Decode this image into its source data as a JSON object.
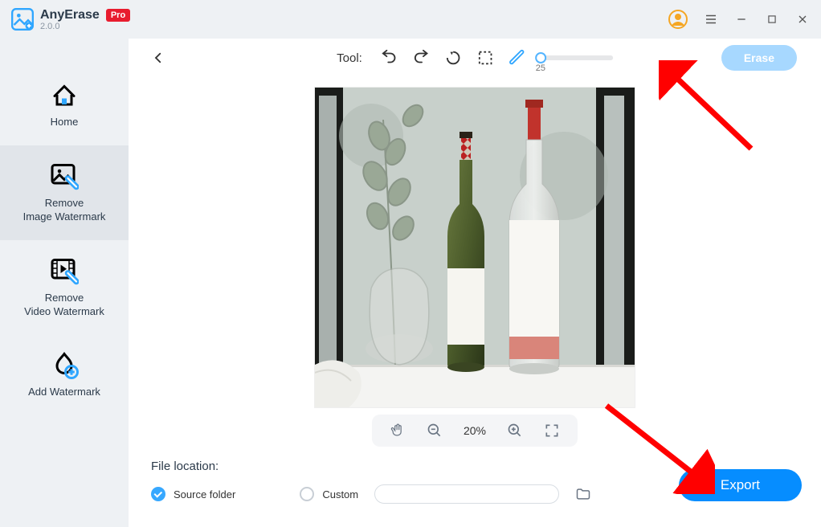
{
  "app": {
    "name": "AnyErase",
    "version": "2.0.0",
    "badge": "Pro"
  },
  "sidebar": {
    "items": [
      {
        "label": "Home"
      },
      {
        "label": "Remove\nImage Watermark"
      },
      {
        "label": "Remove\nVideo Watermark"
      },
      {
        "label": "Add Watermark"
      }
    ],
    "active_index": 1
  },
  "toolbar": {
    "label": "Tool:",
    "brush_size": "25",
    "erase_label": "Erase"
  },
  "zoom": {
    "level": "20%"
  },
  "file_location": {
    "title": "File location:",
    "source_label": "Source folder",
    "custom_label": "Custom",
    "selected": "source",
    "custom_path": ""
  },
  "export": {
    "label": "Export"
  },
  "colors": {
    "accent": "#068dff",
    "accent_light": "#a7d8ff",
    "pro_red": "#e81c2e"
  }
}
